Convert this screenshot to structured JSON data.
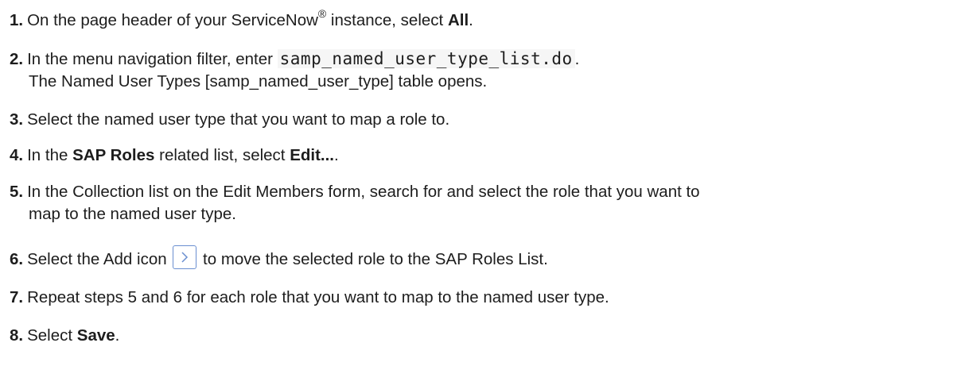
{
  "steps": [
    {
      "number": "1.",
      "before": "On the page header of your ServiceNow",
      "registered": "®",
      "middle": " instance, select ",
      "bold": "All",
      "after": "."
    },
    {
      "number": "2.",
      "before": "In the menu navigation filter, enter ",
      "code": "samp_named_user_type_list.do",
      "after": ".",
      "line2": "The Named User Types [samp_named_user_type] table opens."
    },
    {
      "number": "3.",
      "text": "Select the named user type that you want to map a role to."
    },
    {
      "number": "4.",
      "before": "In the ",
      "bold1": "SAP Roles",
      "middle": " related list, select ",
      "bold2": "Edit...",
      "after": "."
    },
    {
      "number": "5.",
      "line1": "In the Collection list on the Edit Members form, search for and select the role that you want to",
      "line2": "map to the named user type."
    },
    {
      "number": "6.",
      "before": "Select the Add icon ",
      "icon": "chevron-right-icon",
      "after": " to move the selected role to the SAP Roles List."
    },
    {
      "number": "7.",
      "text": "Repeat steps 5 and 6 for each role that you want to map to the named user type."
    },
    {
      "number": "8.",
      "before": "Select ",
      "bold": "Save",
      "after": "."
    }
  ],
  "colors": {
    "text": "#1d1d1d",
    "icon_border": "#6a8fd0"
  }
}
